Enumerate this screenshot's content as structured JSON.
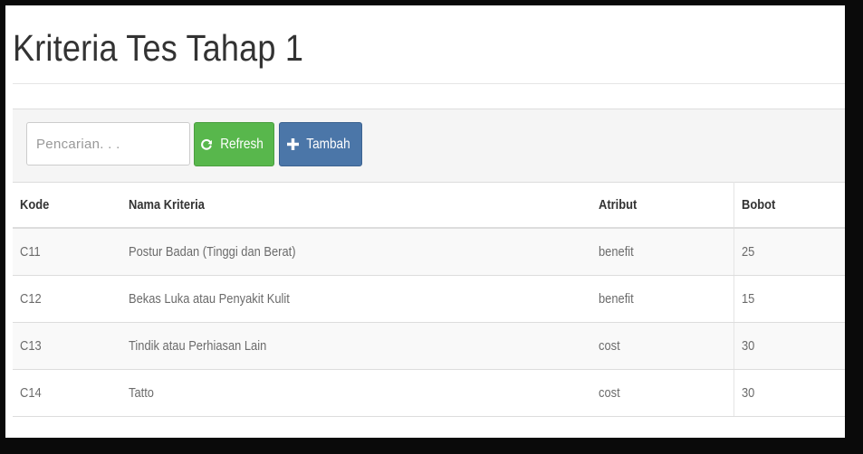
{
  "page": {
    "title": "Kriteria Tes Tahap 1"
  },
  "toolbar": {
    "search_placeholder": "Pencarian. . .",
    "search_value": "",
    "refresh_label": "Refresh",
    "refresh_icon": "refresh-icon",
    "add_label": "Tambah",
    "add_icon": "plus-icon"
  },
  "table": {
    "columns": [
      "Kode",
      "Nama Kriteria",
      "Atribut",
      "Bobot"
    ],
    "rows": [
      [
        "C11",
        "Postur Badan (Tinggi dan Berat)",
        "benefit",
        "25"
      ],
      [
        "C12",
        "Bekas Luka atau Penyakit Kulit",
        "benefit",
        "15"
      ],
      [
        "C13",
        "Tindik atau Perhiasan Lain",
        "cost",
        "30"
      ],
      [
        "C14",
        "Tatto",
        "cost",
        "30"
      ]
    ]
  },
  "colors": {
    "refresh_button": "#58b74c",
    "add_button": "#4b76a8",
    "toolbar_bg": "#f5f5f5",
    "frame_border": "#0a0a0a"
  }
}
